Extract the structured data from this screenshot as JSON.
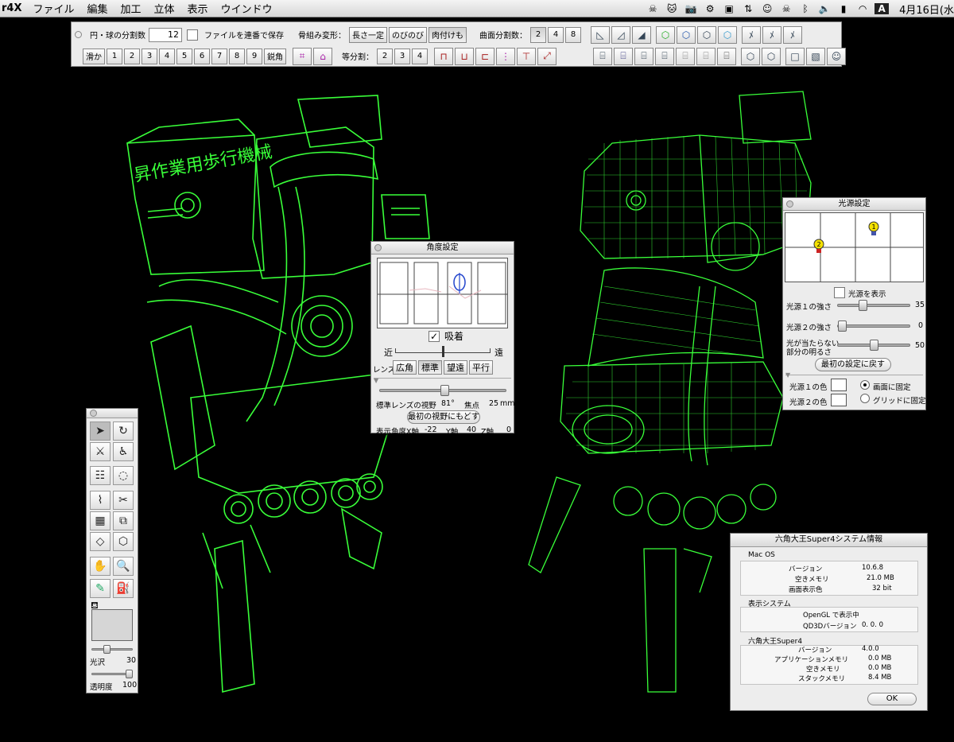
{
  "menubar": {
    "app": "r4X",
    "items": [
      "ファイル",
      "編集",
      "加工",
      "立体",
      "表示",
      "ウインドウ"
    ],
    "clock": "4月16日(水"
  },
  "toolbar": {
    "div_label": "円・球の分割数",
    "div_value": "12",
    "save_label": "ファイルを連番で保存",
    "bone_label": "骨組み変形：",
    "bone_opts": [
      "長さ一定",
      "のびのび",
      "肉付けも"
    ],
    "curve_label": "曲面分割数：",
    "curve_opts": [
      "2",
      "4",
      "8"
    ],
    "smooth_label": "滑か",
    "nums": [
      "1",
      "2",
      "3",
      "4",
      "5",
      "6",
      "7",
      "8",
      "9"
    ],
    "sharp_label": "鋭角",
    "equal_label": "等分割：",
    "equal_opts": [
      "2",
      "3",
      "4"
    ]
  },
  "angle_panel": {
    "title": "角度設定",
    "snap_label": "吸着",
    "near": "近",
    "far": "遠",
    "lens_label": "レンズ",
    "lens_opts": [
      "広角",
      "標準",
      "望遠",
      "平行"
    ],
    "fov_label": "標準レンズの視野",
    "fov_value": "81°",
    "focus_label": "焦点",
    "focus_value": "25",
    "focus_unit": "mm",
    "reset_label": "最初の視野にもどす",
    "angle_label": "表示角度",
    "x_label": "X軸",
    "x_value": "-22",
    "y_label": "Y軸",
    "y_value": "40",
    "z_label": "Z軸",
    "z_value": "0"
  },
  "light_panel": {
    "title": "光源設定",
    "show_label": "光源を表示",
    "light1_label": "光源１の強さ",
    "light1_value": "35",
    "light2_label": "光源２の強さ",
    "light2_value": "0",
    "ambient_label1": "光が当たらない",
    "ambient_label2": "部分の明るさ",
    "ambient_value": "50",
    "reset_label": "最初の設定に戻す",
    "color1_label": "光源１の色",
    "color2_label": "光源２の色",
    "fix_screen": "画面に固定",
    "fix_grid": "グリッドに固定",
    "marker1": "1",
    "marker2": "2",
    "slider_levels": {
      "light1": 0.35,
      "light2": 0.0,
      "ambient": 0.5
    }
  },
  "tool_panel": {
    "gloss_label": "光沢",
    "gloss_value": "30",
    "opacity_label": "透明度",
    "opacity_value": "100",
    "slider_levels": {
      "gloss": 0.3,
      "opacity": 1.0
    }
  },
  "sys_panel": {
    "title": "六角大王Super4システム情報",
    "os_header": "Mac OS",
    "version_label": "バージョン",
    "os_version": "10.6.8",
    "freemem_label": "空きメモリ",
    "os_freemem": "21.0 MB",
    "color_label": "画面表示色",
    "os_color": "32 bit",
    "display_header": "表示システム",
    "opengl_label": "OpenGL で表示中",
    "qd3d_label": "QD3Dバージョン",
    "qd3d_value": "0. 0. 0",
    "app_header": "六角大王Super4",
    "app_version": "4.0.0",
    "appmem_label": "アプリケーションメモリ",
    "appmem_value": "0.0 MB",
    "app_freemem": "0.0 MB",
    "stack_label": "スタックメモリ",
    "stack_value": "8.4 MB",
    "ok_label": "OK"
  },
  "model_text": "昇作業用歩行機械",
  "colors": {
    "wire": "#39ff39",
    "bg": "#000000",
    "panel": "#ececec",
    "light_marker": "#f4e100"
  }
}
